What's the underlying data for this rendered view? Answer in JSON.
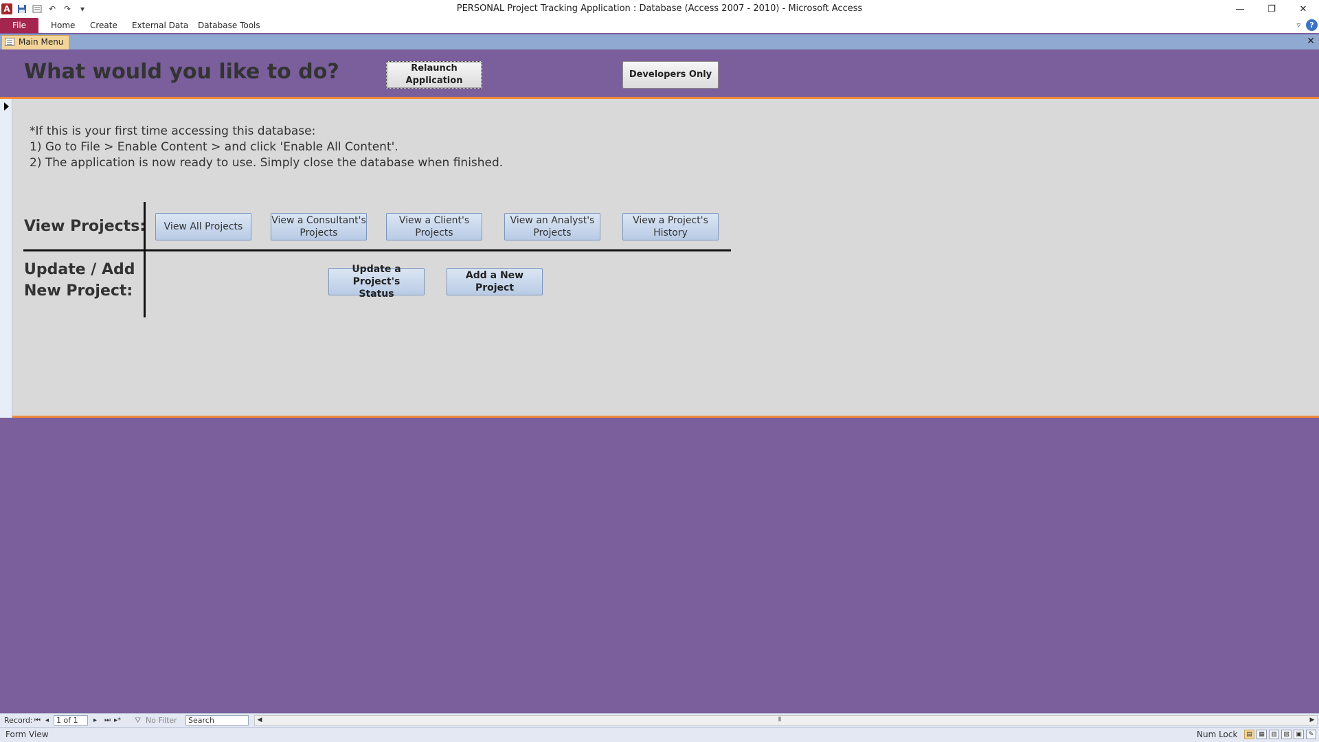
{
  "window": {
    "title": "PERSONAL Project Tracking Application : Database (Access 2007 - 2010)  -  Microsoft Access",
    "minimize": "—",
    "restore": "❐",
    "close": "✕"
  },
  "ribbon": {
    "tabs": [
      "File",
      "Home",
      "Create",
      "External Data",
      "Database Tools"
    ],
    "help": "?"
  },
  "document_tab": {
    "label": "Main Menu",
    "close": "✕"
  },
  "header": {
    "title": "What would you like to do?",
    "relaunch_label": "Relaunch\nApplication",
    "developers_label": "Developers Only"
  },
  "instructions": {
    "line1": "*If this is your first time accessing this database:",
    "line2": "1) Go to File > Enable Content > and click 'Enable All Content'.",
    "line3": "2) The application is now ready to use. Simply close the database when finished."
  },
  "view_section": {
    "label": "View Projects:",
    "buttons": [
      "View All Projects",
      "View a Consultant's\nProjects",
      "View a Client's\nProjects",
      "View an Analyst's\nProjects",
      "View a Project's\nHistory"
    ]
  },
  "update_section": {
    "label": "Update / Add\nNew Project:",
    "buttons": [
      "Update a Project's\nStatus",
      "Add a New Project"
    ]
  },
  "navbar": {
    "record_label": "Record:",
    "record_value": "1 of 1",
    "filter_label": "No Filter",
    "search_label": "Search"
  },
  "statusbar": {
    "view_label": "Form View",
    "numlock": "Num Lock"
  },
  "colors": {
    "background_purple": "#7b5f9c",
    "accent_orange": "#f28a3a",
    "file_tab": "#a4264f",
    "detail_gray": "#d9d9d9"
  }
}
